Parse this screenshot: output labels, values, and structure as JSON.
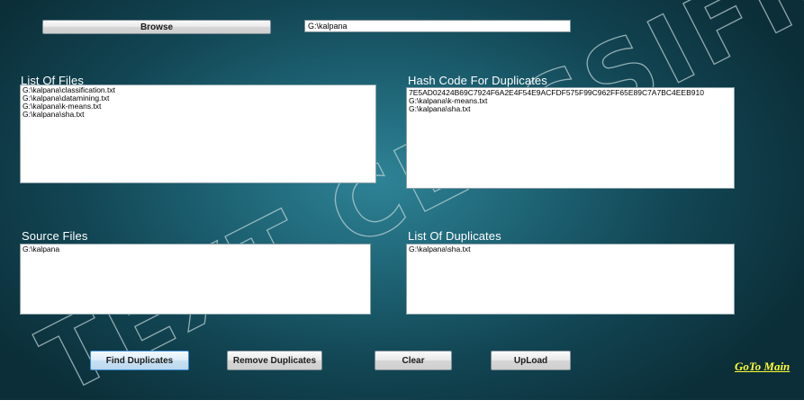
{
  "toolbar": {
    "browse_label": "Browse",
    "path_value": "G:\\kalpana"
  },
  "panels": {
    "list_of_files": {
      "title": "List Of Files",
      "items": [
        "G:\\kalpana\\classification.txt",
        "G:\\kalpana\\datamining.txt",
        "G:\\kalpana\\k-means.txt",
        "G:\\kalpana\\sha.txt"
      ]
    },
    "hash_codes": {
      "title": "Hash Code For Duplicates",
      "items": [
        "7E5AD02424B69C7924F6A2E4F54E9ACFDF575F99C962FF65E89C7A7BC4EEB910",
        "G:\\kalpana\\k-means.txt",
        "G:\\kalpana\\sha.txt"
      ]
    },
    "source_files": {
      "title": "Source Files",
      "items": [
        "G:\\kalpana"
      ]
    },
    "list_of_duplicates": {
      "title": "List Of Duplicates",
      "items": [
        "G:\\kalpana\\sha.txt"
      ]
    }
  },
  "actions": {
    "find_label": "Find Duplicates",
    "remove_label": "Remove Duplicates",
    "clear_label": "Clear",
    "upload_label": "UpLoad",
    "goto_label": "GoTo Main"
  },
  "watermark": {
    "text": "TEXT CLASSIFICATION"
  },
  "colors": {
    "background": "#1d6273",
    "link": "#ffff33",
    "label": "#ffffff"
  }
}
